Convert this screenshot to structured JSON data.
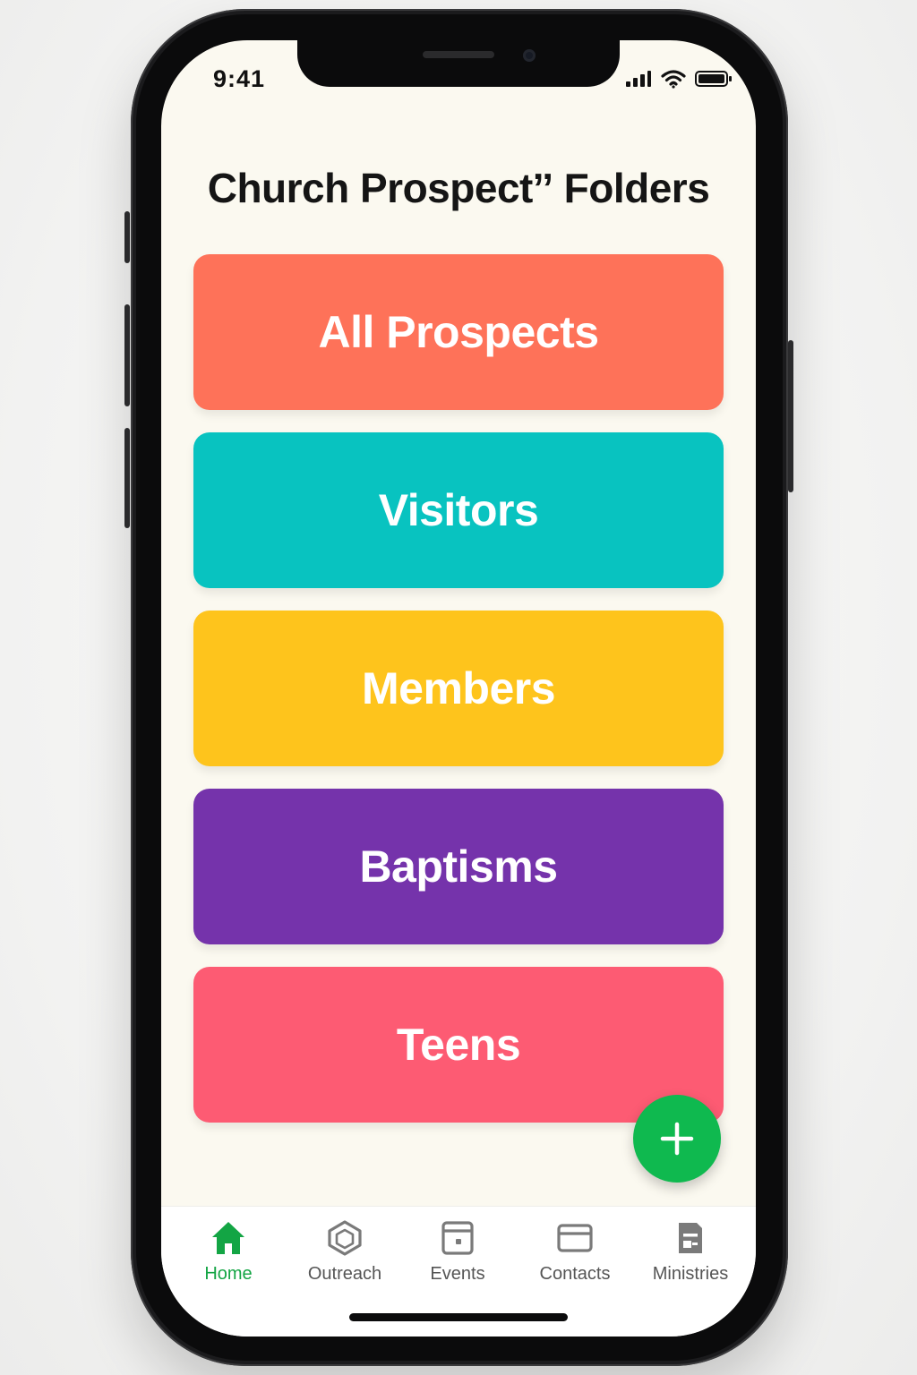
{
  "status_bar": {
    "time": "9:41"
  },
  "page": {
    "title": "Church Prospectˮ Folders"
  },
  "folders": [
    {
      "label": "All Prospects",
      "color": "#fe7259"
    },
    {
      "label": "Visitors",
      "color": "#08c3c0"
    },
    {
      "label": "Members",
      "color": "#fec41c"
    },
    {
      "label": "Baptisms",
      "color": "#7533ab"
    },
    {
      "label": "Teens",
      "color": "#fd5b73"
    }
  ],
  "fab": {
    "icon": "plus-icon",
    "color": "#0fb94f"
  },
  "tabs": [
    {
      "label": "Home",
      "icon": "home-icon",
      "active": true
    },
    {
      "label": "Outreach",
      "icon": "outreach-icon",
      "active": false
    },
    {
      "label": "Events",
      "icon": "events-icon",
      "active": false
    },
    {
      "label": "Contacts",
      "icon": "contacts-icon",
      "active": false
    },
    {
      "label": "Ministries",
      "icon": "ministries-icon",
      "active": false
    }
  ],
  "colors": {
    "accent": "#13a544",
    "screen_background": "#fbf9f0"
  }
}
